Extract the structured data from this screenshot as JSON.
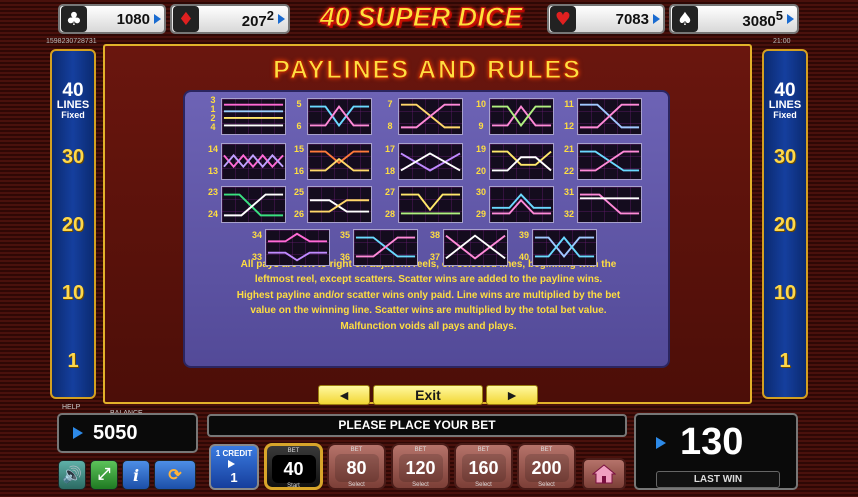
{
  "jackpots": [
    {
      "suit": "club-icon",
      "glyph": "♣",
      "main": "1080",
      "level": ""
    },
    {
      "suit": "diamond-icon",
      "glyph": "♦",
      "main": "207",
      "level": "2"
    },
    {
      "suit": "heart-icon",
      "glyph": "♥",
      "main": "7083",
      "level": ""
    },
    {
      "suit": "spade-icon",
      "glyph": "♠",
      "main": "3080",
      "level": "5"
    }
  ],
  "game_title": "40 SUPER DICE",
  "session_id": "1598230728731",
  "clock": "21:00",
  "side_panel": {
    "count": "40",
    "lines": "LINES",
    "fixed": "Fixed",
    "numbers": [
      "30",
      "20",
      "10",
      "1"
    ]
  },
  "paytable_title": "PAYLINES AND RULES",
  "paylines": [
    {
      "labels": [
        "3",
        "1",
        "2",
        "4"
      ]
    },
    {
      "labels": [
        "5",
        "6"
      ]
    },
    {
      "labels": [
        "7",
        "8"
      ]
    },
    {
      "labels": [
        "10",
        "9"
      ]
    },
    {
      "labels": [
        "11",
        "12"
      ]
    },
    {
      "labels": [
        "14",
        "13"
      ]
    },
    {
      "labels": [
        "15",
        "16"
      ]
    },
    {
      "labels": [
        "17",
        "18"
      ]
    },
    {
      "labels": [
        "19",
        "20"
      ]
    },
    {
      "labels": [
        "21",
        "22"
      ]
    },
    {
      "labels": [
        "23",
        "24"
      ]
    },
    {
      "labels": [
        "25",
        "26"
      ]
    },
    {
      "labels": [
        "27",
        "28"
      ]
    },
    {
      "labels": [
        "30",
        "29"
      ]
    },
    {
      "labels": [
        "31",
        "32"
      ]
    },
    {
      "labels": [
        "34",
        "33"
      ]
    },
    {
      "labels": [
        "35",
        "36"
      ]
    },
    {
      "labels": [
        "38",
        "37"
      ]
    },
    {
      "labels": [
        "39",
        "40"
      ]
    }
  ],
  "rules_lines": [
    "All pays are left to right on adjacent reels, on selected lines, beginning with the",
    "leftmost reel, except scatters. Scatter wins are added to the payline wins.",
    "Highest payline and/or scatter wins only paid. Line wins are multiplied by the bet",
    "value on the winning line. Scatter wins are multiplied by the total bet value.",
    "Malfunction voids all pays and plays."
  ],
  "nav": {
    "prev": "◄",
    "exit": "Exit",
    "next": "►"
  },
  "help_label": "HELP",
  "balance": {
    "label": "BALANCE",
    "value": "5050"
  },
  "message": "PLEASE PLACE YOUR BET",
  "last_win": {
    "value": "130",
    "label": "LAST WIN"
  },
  "controls": {
    "sound": "🔊",
    "fullscreen": "⤢",
    "info": "i",
    "autoplay": "⟳"
  },
  "credit": {
    "top": "1 CREDIT",
    "value": "1"
  },
  "bets": [
    {
      "top": "BET",
      "value": "40",
      "bottom": "Start",
      "selected": true
    },
    {
      "top": "BET",
      "value": "80",
      "bottom": "Select",
      "selected": false
    },
    {
      "top": "BET",
      "value": "120",
      "bottom": "Select",
      "selected": false
    },
    {
      "top": "BET",
      "value": "160",
      "bottom": "Select",
      "selected": false
    },
    {
      "top": "BET",
      "value": "200",
      "bottom": "Select",
      "selected": false
    }
  ],
  "colors": {
    "accent": "#ffde40",
    "panel": "#6d63b5",
    "frame": "#e2b22a"
  }
}
